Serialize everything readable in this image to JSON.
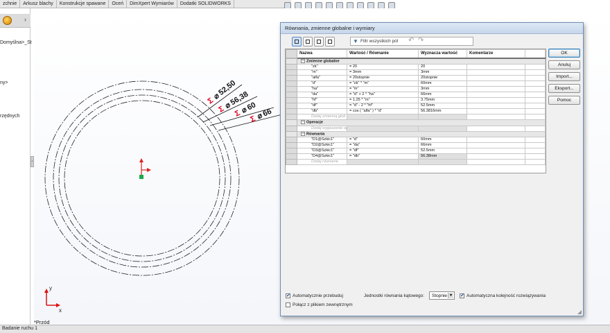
{
  "tabs": [
    "zchnie",
    "Arkusz blachy",
    "Konstrukcje spawane",
    "Oceń",
    "DimXpert Wymiarów",
    "Dodatki SOLIDWORKS"
  ],
  "feature_manager": {
    "items": [
      "Domyślna>_St",
      "ny>",
      "rzędnych"
    ]
  },
  "view_label": "*Przód",
  "status_bar": {
    "tab": "Badanie ruchu 1"
  },
  "sketch": {
    "dimensions": [
      {
        "prefix": "Σ",
        "symbol": "⌀",
        "value": "52,50"
      },
      {
        "prefix": "Σ",
        "symbol": "⌀",
        "value": "56,38"
      },
      {
        "prefix": "Σ",
        "symbol": "⌀",
        "value": "60"
      },
      {
        "prefix": "Σ",
        "symbol": "⌀",
        "value": "66"
      }
    ],
    "axes": {
      "x": "x",
      "y": "y"
    }
  },
  "dialog": {
    "title": "Równania, zmienne globalne i wymiary",
    "filter_placeholder": "Filtr wszystkich pól",
    "columns": [
      "Nazwa",
      "Wartość / Równanie",
      "Wyznacza wartość",
      "Komentarze"
    ],
    "sections": {
      "globals": {
        "title": "Zmienne globalne",
        "rows": [
          {
            "name": "\"zk\"",
            "eq": "= 20",
            "val": "20"
          },
          {
            "name": "\"m\"",
            "eq": "= 3mm",
            "val": "3mm"
          },
          {
            "name": "\"alfa\"",
            "eq": "= 20stopnie",
            "val": "20stopnie"
          },
          {
            "name": "\"d\"",
            "eq": "= \"zk\" * \"m\"",
            "val": "60mm"
          },
          {
            "name": "\"ha\"",
            "eq": "= \"m\"",
            "val": "3mm"
          },
          {
            "name": "\"da\"",
            "eq": "= \"d\" + 2 * \"ha\"",
            "val": "66mm"
          },
          {
            "name": "\"hf\"",
            "eq": "= 1.25 * \"m\"",
            "val": "3.75mm"
          },
          {
            "name": "\"df\"",
            "eq": "= \"d\" - 2 * \"hf\"",
            "val": "52.5mm"
          },
          {
            "name": "\"db\"",
            "eq": "= cos ( \"alfa\" ) * \"d\"",
            "val": "56.3816mm"
          }
        ],
        "add_placeholder": "Dodaj zmienną glob"
      },
      "features": {
        "title": "Operacje",
        "add_placeholder": "Dodaj wygaszenie op"
      },
      "equations": {
        "title": "Równania",
        "rows": [
          {
            "name": "\"D1@Szkic1\"",
            "eq": "= \"d\"",
            "val": "60mm"
          },
          {
            "name": "\"D2@Szkic1\"",
            "eq": "= \"da\"",
            "val": "66mm"
          },
          {
            "name": "\"D3@Szkic1\"",
            "eq": "= \"df\"",
            "val": "52.5mm"
          },
          {
            "name": "\"D4@Szkic1\"",
            "eq": "= \"db\"",
            "val": "56.38mm"
          }
        ],
        "add_placeholder": "Dodaj równanie"
      }
    },
    "buttons": [
      "OK",
      "Anuluj",
      "Import...",
      "Eksport...",
      "Pomoc"
    ],
    "options": {
      "auto_rebuild": "Automatycznie przebuduj",
      "angle_units_label": "Jednostki równania kątowego:",
      "angle_units_value": "Stopnie",
      "auto_order": "Automatyczna kolejność rozwiązywania",
      "link_external": "Połącz z plikiem zewnętrznym"
    }
  },
  "colors": {
    "dimension_red": "#e0001b",
    "dialog_border": "#6e8db3",
    "origin_red": "#e02020",
    "origin_green": "#1aa84b"
  }
}
